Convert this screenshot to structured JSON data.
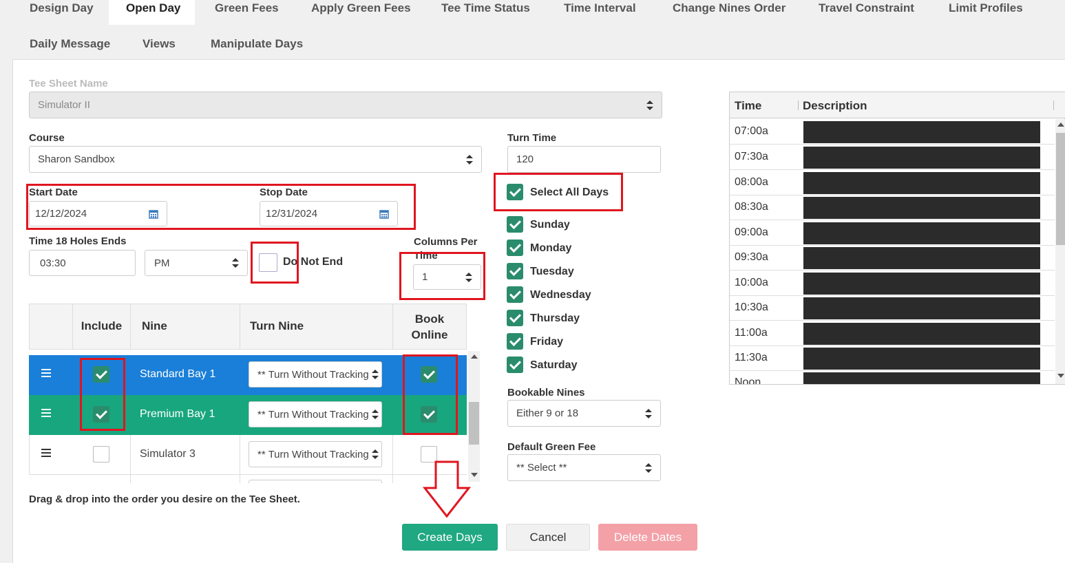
{
  "tabs": [
    {
      "label": "Design Day"
    },
    {
      "label": "Open Day"
    },
    {
      "label": "Green Fees"
    },
    {
      "label": "Apply Green Fees"
    },
    {
      "label": "Tee Time Status"
    },
    {
      "label": "Time Interval"
    },
    {
      "label": "Change Nines Order"
    },
    {
      "label": "Travel Constraint"
    },
    {
      "label": "Limit Profiles"
    },
    {
      "label": "Daily Message"
    },
    {
      "label": "Views"
    },
    {
      "label": "Manipulate Days"
    }
  ],
  "active_tab": "Open Day",
  "form": {
    "tee_sheet_name_label": "Tee Sheet Name",
    "tee_sheet_name_value": "Simulator II",
    "course_label": "Course",
    "course_value": "Sharon Sandbox",
    "start_date_label": "Start Date",
    "start_date_value": "12/12/2024",
    "stop_date_label": "Stop Date",
    "stop_date_value": "12/31/2024",
    "time18_label": "Time 18 Holes Ends",
    "time18_value": "03:30",
    "ampm_value": "PM",
    "do_not_end_label": "Do Not End",
    "columns_per_time_label": "Columns Per Time",
    "columns_per_time_value": "1",
    "turn_time_label": "Turn Time",
    "turn_time_value": "120",
    "select_all_days_label": "Select All Days",
    "days": [
      "Sunday",
      "Monday",
      "Tuesday",
      "Wednesday",
      "Thursday",
      "Friday",
      "Saturday"
    ],
    "bookable_nines_label": "Bookable Nines",
    "bookable_nines_value": "Either 9 or 18",
    "default_green_fee_label": "Default Green Fee",
    "default_green_fee_value": "** Select **"
  },
  "nines_table": {
    "headers": {
      "include": "Include",
      "nine": "Nine",
      "turn_nine": "Turn Nine",
      "book_online": "Book Online"
    },
    "rows": [
      {
        "nine": "Standard Bay 1",
        "turn_nine": "** Turn Without Tracking",
        "include": true,
        "book_online": true
      },
      {
        "nine": "Premium Bay 1",
        "turn_nine": "** Turn Without Tracking",
        "include": true,
        "book_online": true
      },
      {
        "nine": "Simulator 3",
        "turn_nine": "** Turn Without Tracking",
        "include": false,
        "book_online": false
      }
    ],
    "hint": "Drag & drop into the order you desire on the Tee Sheet."
  },
  "buttons": {
    "create": "Create Days",
    "cancel": "Cancel",
    "delete": "Delete Dates"
  },
  "time_table": {
    "headers": {
      "time": "Time",
      "description": "Description"
    },
    "times": [
      "07:00a",
      "07:30a",
      "08:00a",
      "08:30a",
      "09:00a",
      "09:30a",
      "10:00a",
      "10:30a",
      "11:00a",
      "11:30a",
      "Noon"
    ]
  },
  "colors": {
    "accent": "#2a8c6c",
    "row_selected": "#1a7fd8",
    "row_green": "#18a67e",
    "highlight": "#e0151f",
    "delete_disabled": "#f4a0a7",
    "create": "#1fa882"
  }
}
